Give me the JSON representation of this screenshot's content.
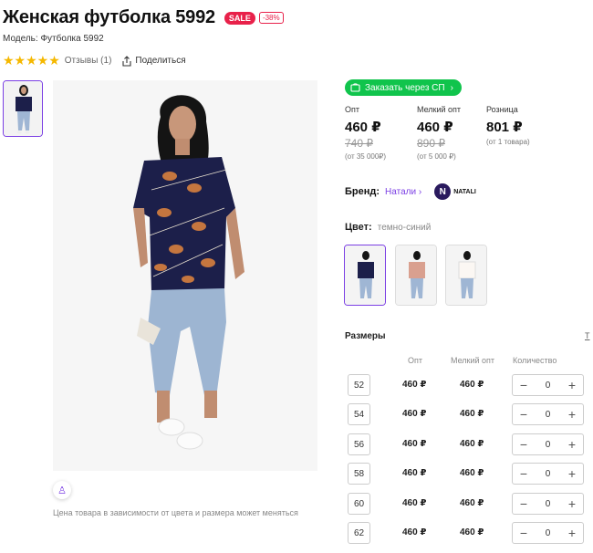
{
  "product": {
    "title": "Женская футболка 5992",
    "sale_badge": "SALE",
    "discount_badge": "-38%",
    "model": "Модель: Футболка 5992",
    "stars": "★★★★★",
    "reviews": "Отзывы (1)",
    "share": "Поделиться",
    "price_note": "Цена товара в зависимости от цвета и размера может меняться"
  },
  "order_button": "Заказать через СП",
  "prices": [
    {
      "label": "Опт",
      "current": "460 ₽",
      "old": "740 ₽",
      "from": "(от 35 000₽)"
    },
    {
      "label": "Мелкий опт",
      "current": "460 ₽",
      "old": "890 ₽",
      "from": "(от 5 000 ₽)"
    },
    {
      "label": "Розница",
      "current": "801 ₽",
      "old": "",
      "from": "(от 1 товара)"
    }
  ],
  "brand": {
    "label": "Бренд:",
    "name": "Натали",
    "logo_text": "NATALI",
    "logo_letter": "N"
  },
  "color": {
    "label": "Цвет:",
    "value": "темно-синий"
  },
  "sizes": {
    "title": "Размеры",
    "table_link": "Т",
    "headers": {
      "opt": "Опт",
      "small_opt": "Мелкий опт",
      "qty": "Количество"
    },
    "rows": [
      {
        "size": "52",
        "opt": "460 ₽",
        "small_opt": "460 ₽",
        "qty": "0"
      },
      {
        "size": "54",
        "opt": "460 ₽",
        "small_opt": "460 ₽",
        "qty": "0"
      },
      {
        "size": "56",
        "opt": "460 ₽",
        "small_opt": "460 ₽",
        "qty": "0"
      },
      {
        "size": "58",
        "opt": "460 ₽",
        "small_opt": "460 ₽",
        "qty": "0"
      },
      {
        "size": "60",
        "opt": "460 ₽",
        "small_opt": "460 ₽",
        "qty": "0"
      },
      {
        "size": "62",
        "opt": "460 ₽",
        "small_opt": "460 ₽",
        "qty": "0"
      }
    ]
  },
  "icons": {
    "minus": "−",
    "plus": "+",
    "chevron": "›",
    "person": "♙"
  },
  "colors": {
    "accent": "#7b3fe4",
    "sale": "#e8214a",
    "order": "#10c44c",
    "shirt_navy": "#1c1f4a"
  }
}
